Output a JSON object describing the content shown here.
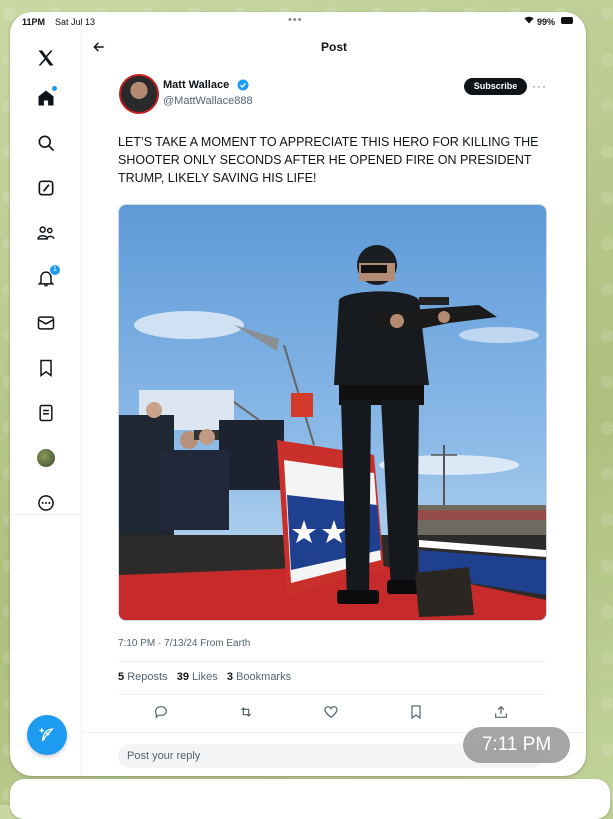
{
  "status_bar": {
    "time": "11PM",
    "date": "Sat Jul 13",
    "battery": "99%"
  },
  "header": {
    "title": "Post"
  },
  "sidebar": {
    "items": [
      {
        "name": "home"
      },
      {
        "name": "explore"
      },
      {
        "name": "grok"
      },
      {
        "name": "communities"
      },
      {
        "name": "notifications",
        "badge": "1"
      },
      {
        "name": "messages"
      },
      {
        "name": "bookmarks"
      },
      {
        "name": "lists"
      },
      {
        "name": "profile"
      },
      {
        "name": "more"
      }
    ]
  },
  "tweet": {
    "author_name": "Matt Wallace",
    "author_handle": "@MattWallace888",
    "subscribe_label": "Subscribe",
    "text": "LET’S TAKE A MOMENT TO APPRECIATE THIS HERO FOR KILLING THE SHOOTER ONLY SECONDS AFTER HE OPENED FIRE ON PRESIDENT TRUMP, LIKELY SAVING HIS LIFE!",
    "timestamp": "7:10 PM · 7/13/24 From Earth",
    "stats": {
      "reposts_count": "5",
      "reposts_label": "Reposts",
      "likes_count": "39",
      "likes_label": "Likes",
      "bookmarks_count": "3",
      "bookmarks_label": "Bookmarks"
    }
  },
  "reply": {
    "placeholder": "Post your reply"
  },
  "overlay_time": "7:11 PM",
  "colors": {
    "accent": "#1d9bf0",
    "text": "#0f1419",
    "secondary": "#536471"
  }
}
